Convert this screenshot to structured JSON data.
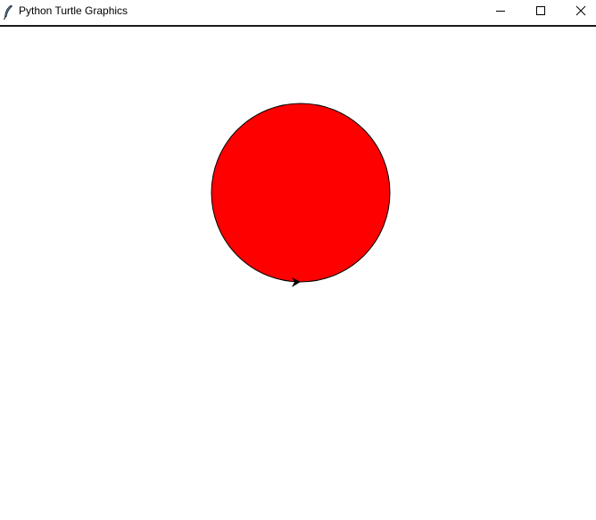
{
  "window": {
    "title": "Python Turtle Graphics",
    "app_icon": "feather-icon",
    "controls": {
      "minimize_icon": "minimize-icon",
      "maximize_icon": "maximize-icon",
      "close_icon": "close-icon"
    }
  },
  "canvas": {
    "background": "#ffffff",
    "circle": {
      "fill_color": "#ff0000",
      "outline_color": "#000000"
    },
    "turtle": {
      "shape": "classic-arrow",
      "color": "#000000"
    }
  }
}
